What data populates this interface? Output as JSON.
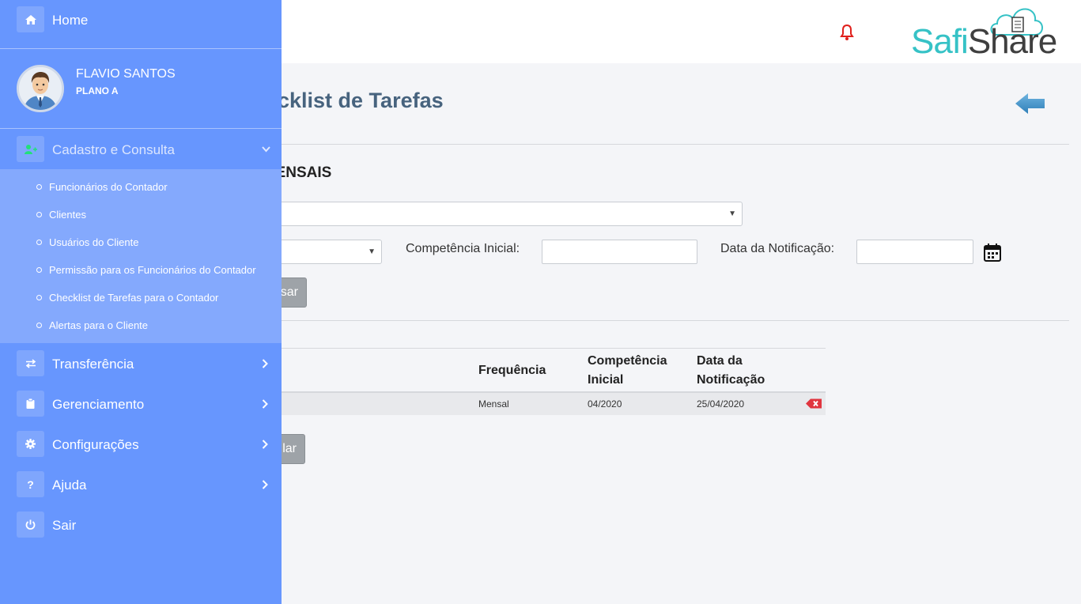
{
  "header": {
    "logo": {
      "part1": "Safi",
      "part2": "Share",
      "colors": {
        "safi": "#36c2c6",
        "share": "#3f3f3f"
      }
    },
    "notification_icon": "bell-icon",
    "notification_color": "#e0201c"
  },
  "main": {
    "page_title": "Checklist de Tarefas",
    "section_title": "OS MENSAIS",
    "filters": {
      "competencia_label": "Competência Inicial:",
      "competencia_value": "",
      "notificacao_label": "Data da Notificação:",
      "notificacao_value": ""
    },
    "search_button": "sar",
    "table": {
      "columns": [
        "Frequência",
        "Competência\nInicial",
        "Data da\nNotificação"
      ],
      "rows": [
        {
          "frequencia": "Mensal",
          "competencia": "04/2020",
          "notificacao": "25/04/2020"
        }
      ]
    },
    "cancel_button": "lar"
  },
  "sidebar": {
    "home": "Home",
    "user": {
      "name": "FLAVIO SANTOS",
      "plan": "PLANO A"
    },
    "cadastro": {
      "label": "Cadastro e Consulta",
      "items": [
        "Funcionários do Contador",
        "Clientes",
        "Usuários do Cliente",
        "Permissão para os Funcionários do Contador",
        "Checklist de Tarefas para o Contador",
        "Alertas para o Cliente"
      ]
    },
    "menu": [
      {
        "label": "Transferência",
        "icon": "exchange-icon"
      },
      {
        "label": "Gerenciamento",
        "icon": "clipboard-icon"
      },
      {
        "label": "Configurações",
        "icon": "gear-icon"
      },
      {
        "label": "Ajuda",
        "icon": "question-icon"
      },
      {
        "label": "Sair",
        "icon": "power-icon"
      }
    ],
    "colors": {
      "background": "#6796fe",
      "submenu": "#84a9fd",
      "cadastro_icon": "#22e07a"
    }
  }
}
